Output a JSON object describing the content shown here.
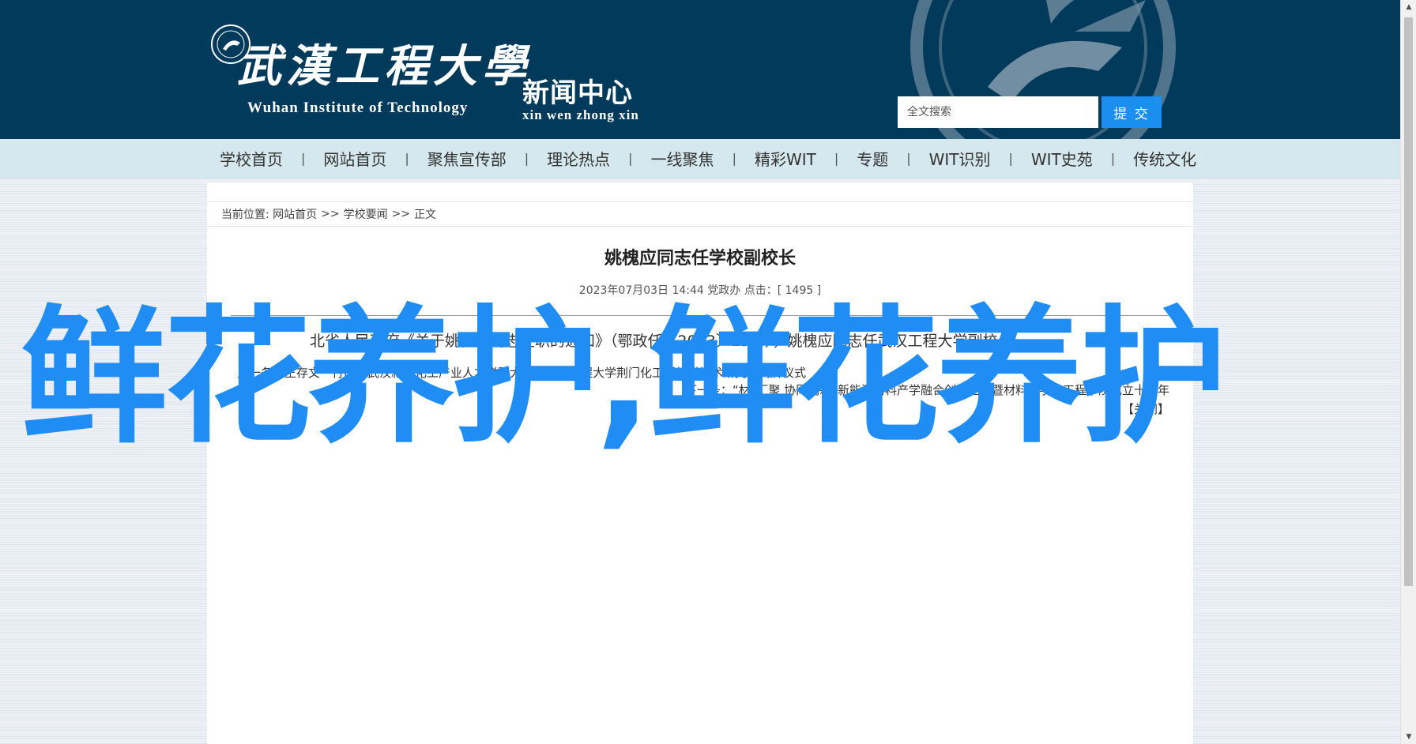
{
  "header": {
    "logo_cn": "武漢工程大學",
    "logo_en": "Wuhan Institute of Technology",
    "section_cn": "新闻中心",
    "section_en": "xin wen zhong xin",
    "search": {
      "placeholder": "全文搜索",
      "button_label": "提 交"
    }
  },
  "nav": {
    "items": [
      "学校首页",
      "网站首页",
      "聚焦宣传部",
      "理论热点",
      "一线聚焦",
      "精彩WIT",
      "专题",
      "WIT识别",
      "WIT史苑",
      "传统文化"
    ],
    "separator": "|"
  },
  "breadcrumb": {
    "prefix": "当前位置:",
    "items": [
      "网站首页",
      "学校要闻",
      "正文"
    ],
    "separator": ">>"
  },
  "article": {
    "title": "姚槐应同志任学校副校长",
    "meta": "2023年07月03日 14:44 党政办 点击：[ 1495 ]",
    "body_visible": "北省人民政府《关于姚槐应同志任职的通知》（鄂政任〔2023〕15号），姚槐应同志任武汉工程大学副校长。",
    "prev_label": "上一条：",
    "prev_title": "王存文一行出席武汉新区化工产业人才联盟大会暨武汉工程大学荆门化工新材料技术研究院揭牌仪式",
    "next_label": "下一条：",
    "next_title": "“材”汇聚 协同创新”新能源材料产学融合创新论坛暨材料科学与工程学院成立十周年",
    "close_label": "【关闭】"
  },
  "overlay": {
    "text": "鲜花养护,鲜花养护",
    "color": "#1f8df4"
  },
  "colors": {
    "header_bg": "#023a5b",
    "nav_bg": "#d4e8ee",
    "search_button": "#1a8ff0"
  },
  "scrollbar": {
    "up_icon": "▲",
    "down_icon": "▼"
  }
}
